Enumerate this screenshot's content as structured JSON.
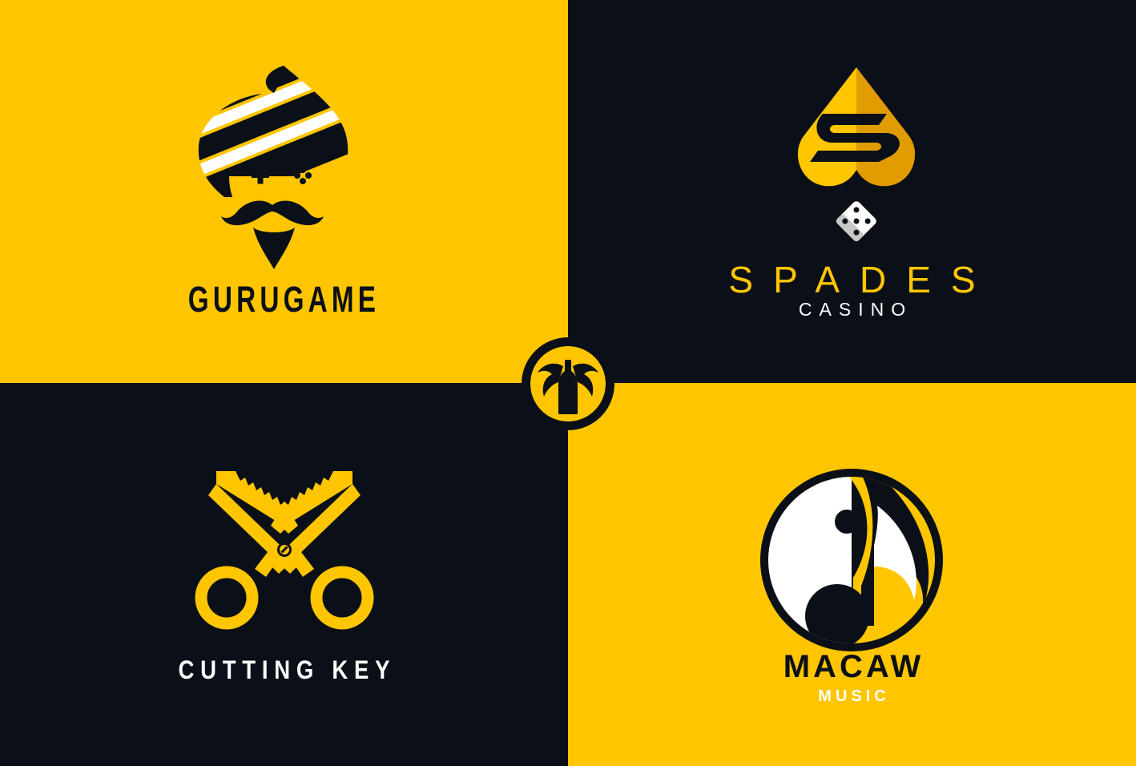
{
  "colors": {
    "yellow": "#ffc600",
    "navy": "#0b0f17",
    "dark_gold": "#e09c00",
    "white": "#ffffff",
    "grey": "#c8c8c8"
  },
  "logos": [
    {
      "id": "gurugame",
      "name": "GURUGAME",
      "icon": "turban-guru-gamepad-icon",
      "background": "#ffc600",
      "foreground": "#0b0f17"
    },
    {
      "id": "spades",
      "name": "SPADES",
      "subtitle": "CASINO",
      "icon": "spade-dice-icon",
      "background": "#0b0f17",
      "foreground": "#ffc600"
    },
    {
      "id": "cutting_key",
      "name": "CUTTING KEY",
      "icon": "key-scissors-icon",
      "background": "#0b0f17",
      "foreground": "#ffffff"
    },
    {
      "id": "macaw",
      "name": "MACAW",
      "subtitle": "MUSIC",
      "icon": "macaw-music-note-icon",
      "background": "#ffc600",
      "foreground": "#0b0f17"
    }
  ],
  "center_badge": {
    "icon": "bottle-birds-badge-icon"
  }
}
